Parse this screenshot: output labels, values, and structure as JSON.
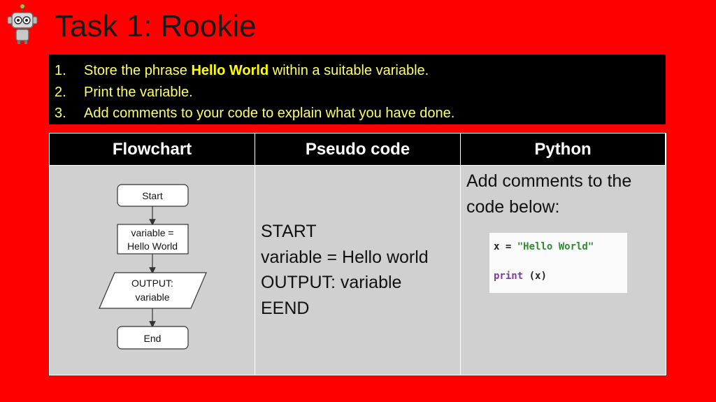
{
  "title": "Task 1: Rookie",
  "tasks": [
    {
      "num": "1.",
      "before": "Store the phrase ",
      "bold": "Hello World",
      "after": " within a suitable variable."
    },
    {
      "num": "2.",
      "text": "Print the variable."
    },
    {
      "num": "3.",
      "text": "Add comments to your code to explain what you have done."
    }
  ],
  "table": {
    "headers": [
      "Flowchart",
      "Pseudo code",
      "Python"
    ]
  },
  "flowchart": {
    "start": "Start",
    "assign_line1": "variable =",
    "assign_line2": "Hello World",
    "output_line1": "OUTPUT:",
    "output_line2": "variable",
    "end": "End"
  },
  "pseudocode": [
    "START",
    "variable = Hello world",
    "OUTPUT: variable",
    "EEND"
  ],
  "python": {
    "instruction": "Add comments to the code below:",
    "code_line1_var": "x = ",
    "code_line1_str": "\"Hello World\"",
    "code_line2_kw": "print",
    "code_line2_rest": " (x)"
  },
  "colors": {
    "background": "#ff0000",
    "task_box": "#000000",
    "task_text": "#ffff66",
    "cell_bg": "#d0d0d0"
  },
  "icons": {
    "logo": "robot-icon"
  }
}
